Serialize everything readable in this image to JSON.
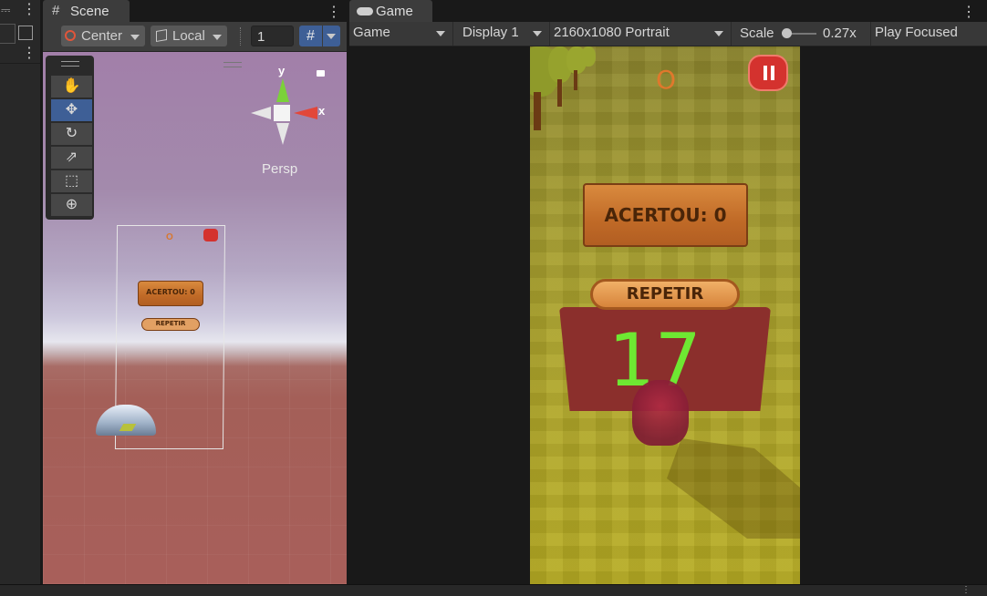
{
  "scene_panel": {
    "tab_label": "Scene",
    "pivot_label": "Center",
    "space_label": "Local",
    "grid_value": "1",
    "axis_y": "y",
    "axis_x": "x",
    "persp_label": "Persp",
    "canvas": {
      "score_text": "ACERTOU: 0",
      "repeat_text": "REPETIR",
      "ring_text": "O"
    }
  },
  "game_panel": {
    "tab_label": "Game",
    "mode_select": "Game",
    "display_select": "Display 1",
    "resolution_select": "2160x1080 Portrait",
    "scale_label": "Scale",
    "scale_value": "0.27x",
    "scale_level": 0.05,
    "play_focused": "Play Focused",
    "screen": {
      "ring_text": "O",
      "score_text": "ACERTOU: 0",
      "repeat_text": "REPETIR",
      "countdown": "17"
    }
  },
  "colors": {
    "toolbar": "#3c3c3c",
    "selected_blue": "#3e5f96",
    "countdown_green": "#6ee832",
    "pause_red": "#d4322e"
  },
  "icons": [
    "lock-icon",
    "kebab-menu-icon",
    "hash-icon",
    "gamepad-icon",
    "hand-tool-icon",
    "move-tool-icon",
    "rotate-tool-icon",
    "scale-tool-icon",
    "rect-tool-icon",
    "transform-tool-icon",
    "pause-icon"
  ]
}
